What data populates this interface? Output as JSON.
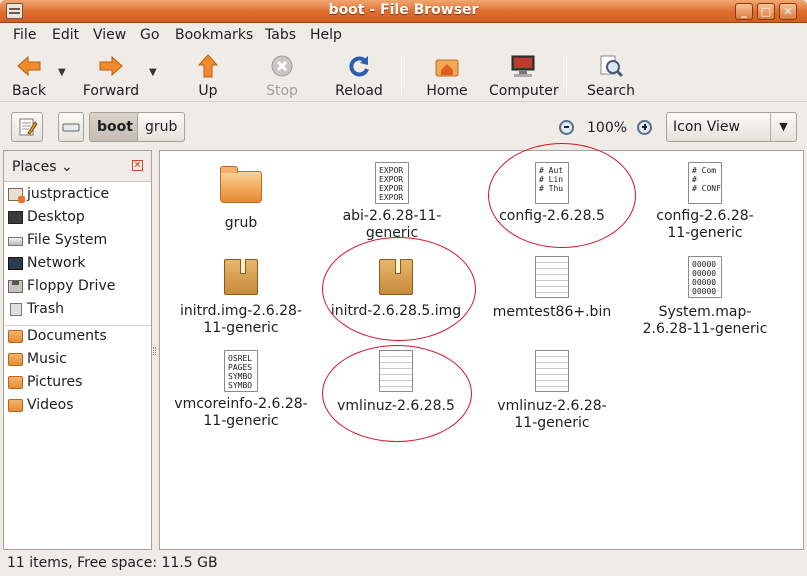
{
  "window": {
    "title": "boot - File Browser"
  },
  "menu": [
    "File",
    "Edit",
    "View",
    "Go",
    "Bookmarks",
    "Tabs",
    "Help"
  ],
  "toolbar": {
    "back": "Back",
    "forward": "Forward",
    "up": "Up",
    "stop": "Stop",
    "reload": "Reload",
    "home": "Home",
    "computer": "Computer",
    "search": "Search"
  },
  "location": {
    "crumbs": [
      "boot",
      "grub"
    ],
    "zoom": "100%",
    "view_mode": "Icon View"
  },
  "sidebar": {
    "header": "Places",
    "items": [
      {
        "label": "justpractice",
        "icon": "home-folder-icon"
      },
      {
        "label": "Desktop",
        "icon": "desktop-icon"
      },
      {
        "label": "File System",
        "icon": "drive-icon"
      },
      {
        "label": "Network",
        "icon": "network-icon"
      },
      {
        "label": "Floppy Drive",
        "icon": "floppy-icon"
      },
      {
        "label": "Trash",
        "icon": "trash-icon"
      },
      {
        "label": "Documents",
        "icon": "folder-icon"
      },
      {
        "label": "Music",
        "icon": "folder-icon"
      },
      {
        "label": "Pictures",
        "icon": "folder-icon"
      },
      {
        "label": "Videos",
        "icon": "folder-icon"
      }
    ]
  },
  "files": [
    {
      "name": "grub",
      "kind": "folder"
    },
    {
      "name": "abi-2.6.28-11-generic",
      "kind": "text",
      "preview": "EXPOR\nEXPOR\nEXPOR\nEXPOR"
    },
    {
      "name": "config-2.6.28.5",
      "kind": "text",
      "preview": "# Aut\n# Lin\n# Thu"
    },
    {
      "name": "config-2.6.28-11-generic",
      "kind": "text",
      "preview": "# Com\n#\n# CONFI"
    },
    {
      "name": "initrd.img-2.6.28-11-generic",
      "kind": "package"
    },
    {
      "name": "initrd-2.6.28.5.img",
      "kind": "package"
    },
    {
      "name": "memtest86+.bin",
      "kind": "text-plain"
    },
    {
      "name": "System.map-2.6.28-11-generic",
      "kind": "text",
      "preview": "00000\n00000\n00000\n00000"
    },
    {
      "name": "vmcoreinfo-2.6.28-11-generic",
      "kind": "text",
      "preview": "OSREL\nPAGES\nSYMBO\nSYMBO"
    },
    {
      "name": "vmlinuz-2.6.28.5",
      "kind": "text-plain"
    },
    {
      "name": "vmlinuz-2.6.28-11-generic",
      "kind": "text-plain"
    }
  ],
  "annotations": {
    "color": "#d4142b"
  },
  "status": "11 items, Free space: 11.5 GB"
}
